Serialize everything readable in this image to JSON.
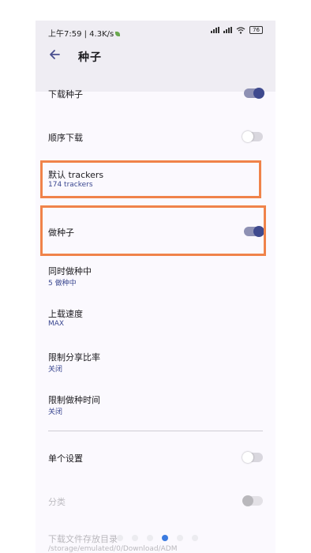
{
  "status": {
    "time_speed": "上午7:59 | 4.3K/s",
    "battery": "76"
  },
  "appbar": {
    "title": "种子",
    "back_icon": "arrow-left-icon"
  },
  "settings": [
    {
      "label": "下载种子",
      "toggle": "on"
    },
    {
      "label": "顺序下载",
      "toggle": "off"
    },
    {
      "label": "默认 trackers",
      "sub": "174 trackers"
    },
    {
      "label": "做种子",
      "toggle": "on"
    },
    {
      "label": "同时做种中",
      "sub": "5 做种中"
    },
    {
      "label": "上载速度",
      "sub": "MAX"
    },
    {
      "label": "限制分享比率",
      "sub": "关闭"
    },
    {
      "label": "限制做种时间",
      "sub": "关闭"
    },
    {
      "label": "单个设置",
      "toggle": "off"
    },
    {
      "label": "分类",
      "toggle": "disabled"
    },
    {
      "label": "下载文件存放目录",
      "sub": "/storage/emulated/0/Download/ADM"
    }
  ],
  "colors": {
    "accent": "#3f4a8e",
    "highlight": "#f0834a"
  },
  "pager": {
    "page_count": 6,
    "active_index": 3
  }
}
